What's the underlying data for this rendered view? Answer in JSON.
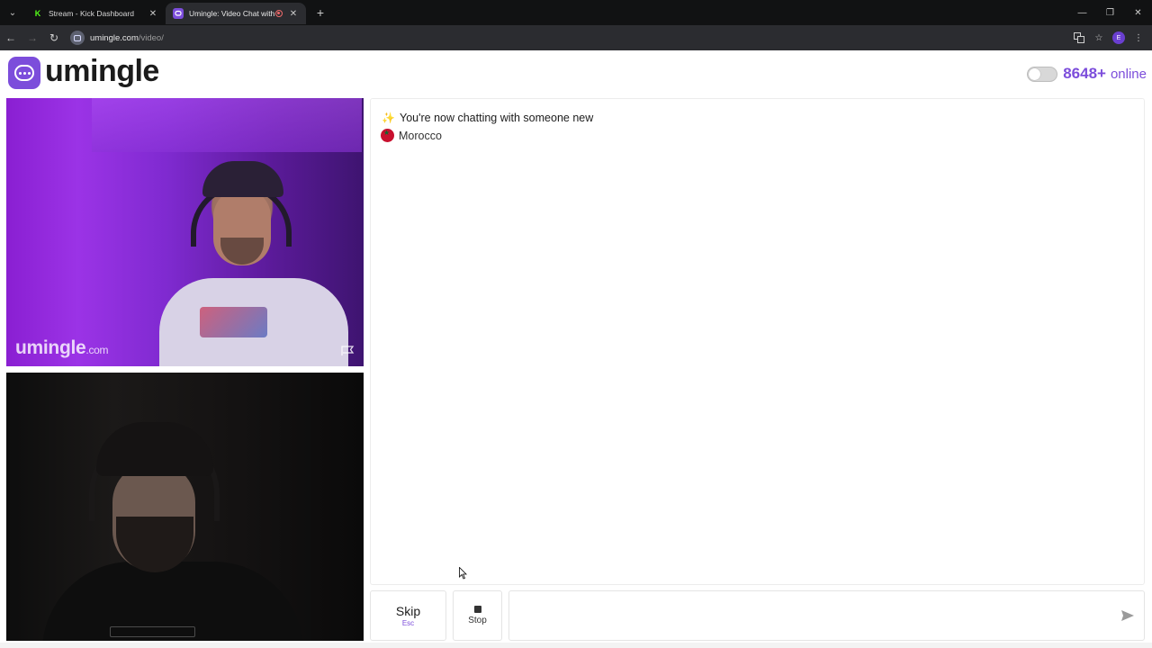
{
  "browser": {
    "tabs": [
      {
        "title": "Stream - Kick Dashboard",
        "favicon": "K",
        "active": false
      },
      {
        "title": "Umingle: Video Chat with St",
        "favicon": "chat-bubble",
        "active": true
      }
    ],
    "url_host": "umingle.com",
    "url_path": "/video/",
    "profile_initial": "E"
  },
  "header": {
    "logo_text": "umingle",
    "online_count": "8648+",
    "online_label": "online"
  },
  "stranger_video": {
    "watermark": "umingle",
    "watermark_suffix": ".com"
  },
  "chat": {
    "system_message": "You're now chatting with someone new",
    "country": "Morocco"
  },
  "controls": {
    "skip_label": "Skip",
    "skip_hint": "Esc",
    "stop_label": "Stop",
    "message_placeholder": ""
  },
  "colors": {
    "accent": "#7c4ddb",
    "country_flag": "#c8102e"
  }
}
